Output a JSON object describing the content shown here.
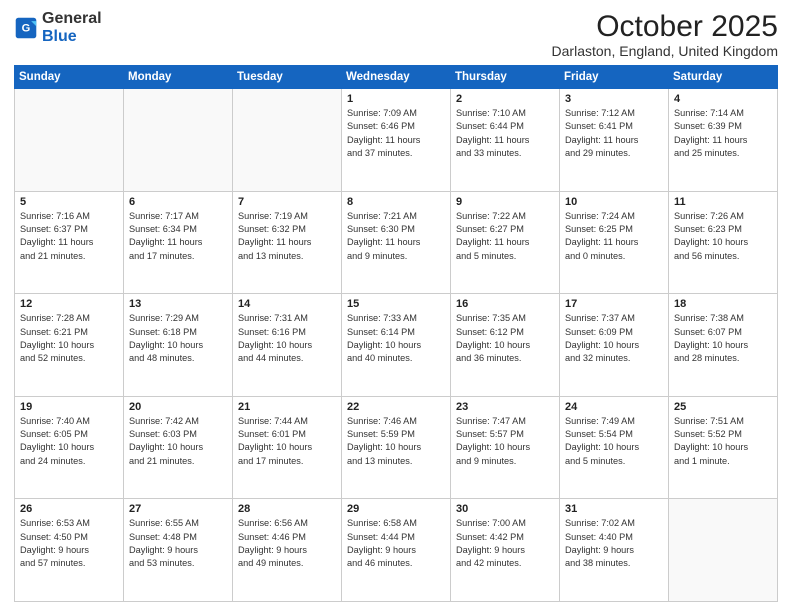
{
  "header": {
    "logo_general": "General",
    "logo_blue": "Blue",
    "month_year": "October 2025",
    "location": "Darlaston, England, United Kingdom"
  },
  "days_of_week": [
    "Sunday",
    "Monday",
    "Tuesday",
    "Wednesday",
    "Thursday",
    "Friday",
    "Saturday"
  ],
  "weeks": [
    [
      {
        "day": "",
        "info": ""
      },
      {
        "day": "",
        "info": ""
      },
      {
        "day": "",
        "info": ""
      },
      {
        "day": "1",
        "info": "Sunrise: 7:09 AM\nSunset: 6:46 PM\nDaylight: 11 hours\nand 37 minutes."
      },
      {
        "day": "2",
        "info": "Sunrise: 7:10 AM\nSunset: 6:44 PM\nDaylight: 11 hours\nand 33 minutes."
      },
      {
        "day": "3",
        "info": "Sunrise: 7:12 AM\nSunset: 6:41 PM\nDaylight: 11 hours\nand 29 minutes."
      },
      {
        "day": "4",
        "info": "Sunrise: 7:14 AM\nSunset: 6:39 PM\nDaylight: 11 hours\nand 25 minutes."
      }
    ],
    [
      {
        "day": "5",
        "info": "Sunrise: 7:16 AM\nSunset: 6:37 PM\nDaylight: 11 hours\nand 21 minutes."
      },
      {
        "day": "6",
        "info": "Sunrise: 7:17 AM\nSunset: 6:34 PM\nDaylight: 11 hours\nand 17 minutes."
      },
      {
        "day": "7",
        "info": "Sunrise: 7:19 AM\nSunset: 6:32 PM\nDaylight: 11 hours\nand 13 minutes."
      },
      {
        "day": "8",
        "info": "Sunrise: 7:21 AM\nSunset: 6:30 PM\nDaylight: 11 hours\nand 9 minutes."
      },
      {
        "day": "9",
        "info": "Sunrise: 7:22 AM\nSunset: 6:27 PM\nDaylight: 11 hours\nand 5 minutes."
      },
      {
        "day": "10",
        "info": "Sunrise: 7:24 AM\nSunset: 6:25 PM\nDaylight: 11 hours\nand 0 minutes."
      },
      {
        "day": "11",
        "info": "Sunrise: 7:26 AM\nSunset: 6:23 PM\nDaylight: 10 hours\nand 56 minutes."
      }
    ],
    [
      {
        "day": "12",
        "info": "Sunrise: 7:28 AM\nSunset: 6:21 PM\nDaylight: 10 hours\nand 52 minutes."
      },
      {
        "day": "13",
        "info": "Sunrise: 7:29 AM\nSunset: 6:18 PM\nDaylight: 10 hours\nand 48 minutes."
      },
      {
        "day": "14",
        "info": "Sunrise: 7:31 AM\nSunset: 6:16 PM\nDaylight: 10 hours\nand 44 minutes."
      },
      {
        "day": "15",
        "info": "Sunrise: 7:33 AM\nSunset: 6:14 PM\nDaylight: 10 hours\nand 40 minutes."
      },
      {
        "day": "16",
        "info": "Sunrise: 7:35 AM\nSunset: 6:12 PM\nDaylight: 10 hours\nand 36 minutes."
      },
      {
        "day": "17",
        "info": "Sunrise: 7:37 AM\nSunset: 6:09 PM\nDaylight: 10 hours\nand 32 minutes."
      },
      {
        "day": "18",
        "info": "Sunrise: 7:38 AM\nSunset: 6:07 PM\nDaylight: 10 hours\nand 28 minutes."
      }
    ],
    [
      {
        "day": "19",
        "info": "Sunrise: 7:40 AM\nSunset: 6:05 PM\nDaylight: 10 hours\nand 24 minutes."
      },
      {
        "day": "20",
        "info": "Sunrise: 7:42 AM\nSunset: 6:03 PM\nDaylight: 10 hours\nand 21 minutes."
      },
      {
        "day": "21",
        "info": "Sunrise: 7:44 AM\nSunset: 6:01 PM\nDaylight: 10 hours\nand 17 minutes."
      },
      {
        "day": "22",
        "info": "Sunrise: 7:46 AM\nSunset: 5:59 PM\nDaylight: 10 hours\nand 13 minutes."
      },
      {
        "day": "23",
        "info": "Sunrise: 7:47 AM\nSunset: 5:57 PM\nDaylight: 10 hours\nand 9 minutes."
      },
      {
        "day": "24",
        "info": "Sunrise: 7:49 AM\nSunset: 5:54 PM\nDaylight: 10 hours\nand 5 minutes."
      },
      {
        "day": "25",
        "info": "Sunrise: 7:51 AM\nSunset: 5:52 PM\nDaylight: 10 hours\nand 1 minute."
      }
    ],
    [
      {
        "day": "26",
        "info": "Sunrise: 6:53 AM\nSunset: 4:50 PM\nDaylight: 9 hours\nand 57 minutes."
      },
      {
        "day": "27",
        "info": "Sunrise: 6:55 AM\nSunset: 4:48 PM\nDaylight: 9 hours\nand 53 minutes."
      },
      {
        "day": "28",
        "info": "Sunrise: 6:56 AM\nSunset: 4:46 PM\nDaylight: 9 hours\nand 49 minutes."
      },
      {
        "day": "29",
        "info": "Sunrise: 6:58 AM\nSunset: 4:44 PM\nDaylight: 9 hours\nand 46 minutes."
      },
      {
        "day": "30",
        "info": "Sunrise: 7:00 AM\nSunset: 4:42 PM\nDaylight: 9 hours\nand 42 minutes."
      },
      {
        "day": "31",
        "info": "Sunrise: 7:02 AM\nSunset: 4:40 PM\nDaylight: 9 hours\nand 38 minutes."
      },
      {
        "day": "",
        "info": ""
      }
    ]
  ]
}
